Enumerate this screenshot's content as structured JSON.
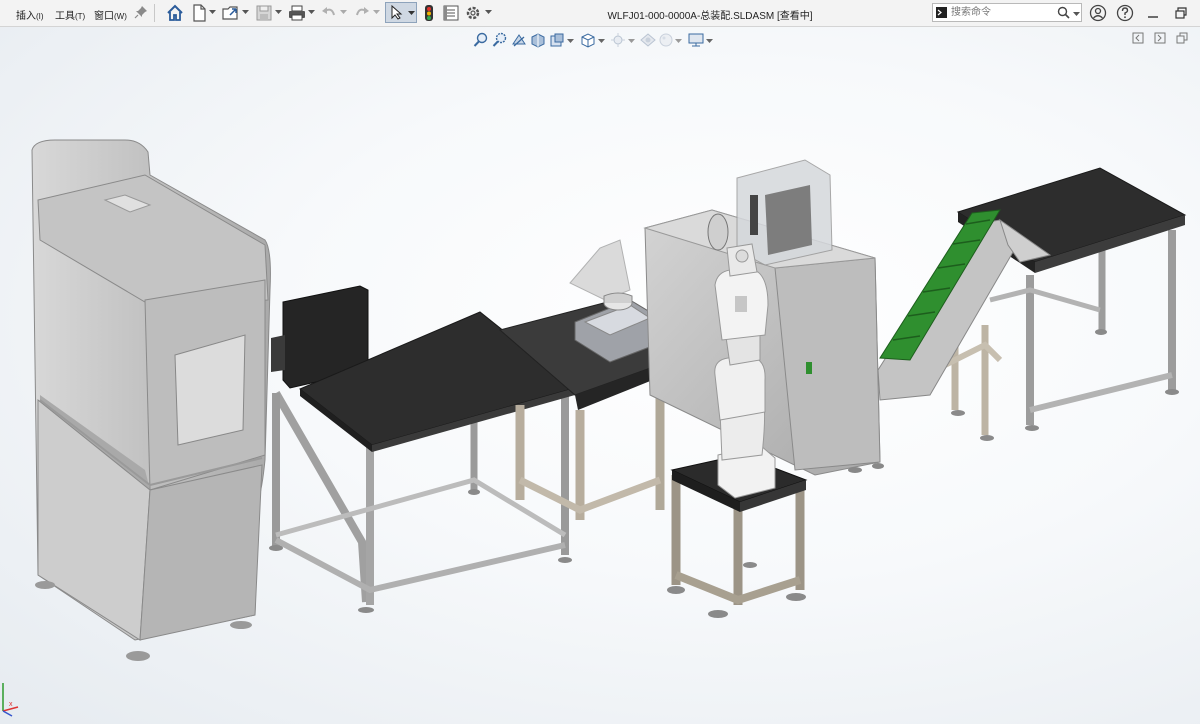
{
  "menu": {
    "insert": "插入",
    "insert_acc": "(I)",
    "tools": "工具",
    "tools_acc": "(T)",
    "window": "窗口",
    "window_acc": "(W)"
  },
  "document": {
    "title": "WLFJ01-000-0000A-总装配.SLDASM [查看中]"
  },
  "search": {
    "placeholder": "搜索命令"
  },
  "colors": {
    "toolbar_bg": "#f3f3f3",
    "machine_gray": "#b9b9b9",
    "tabletop_black": "#2e2e2e",
    "frame_gray": "#9c9c9c",
    "conveyor_green": "#2f8f2f",
    "robot_white": "#efefef"
  },
  "icons": {
    "pin": "pin-icon",
    "home": "home-icon",
    "new": "new-file-icon",
    "open": "open-file-icon",
    "save": "save-icon",
    "print": "print-icon",
    "undo": "undo-icon",
    "redo": "redo-icon",
    "select": "select-cursor-icon",
    "rebuild": "traffic-light-icon",
    "file_props": "file-properties-icon",
    "options": "gear-icon",
    "search": "search-icon",
    "user": "user-icon",
    "help": "help-icon",
    "minimize": "minimize-icon",
    "restore": "restore-icon"
  }
}
